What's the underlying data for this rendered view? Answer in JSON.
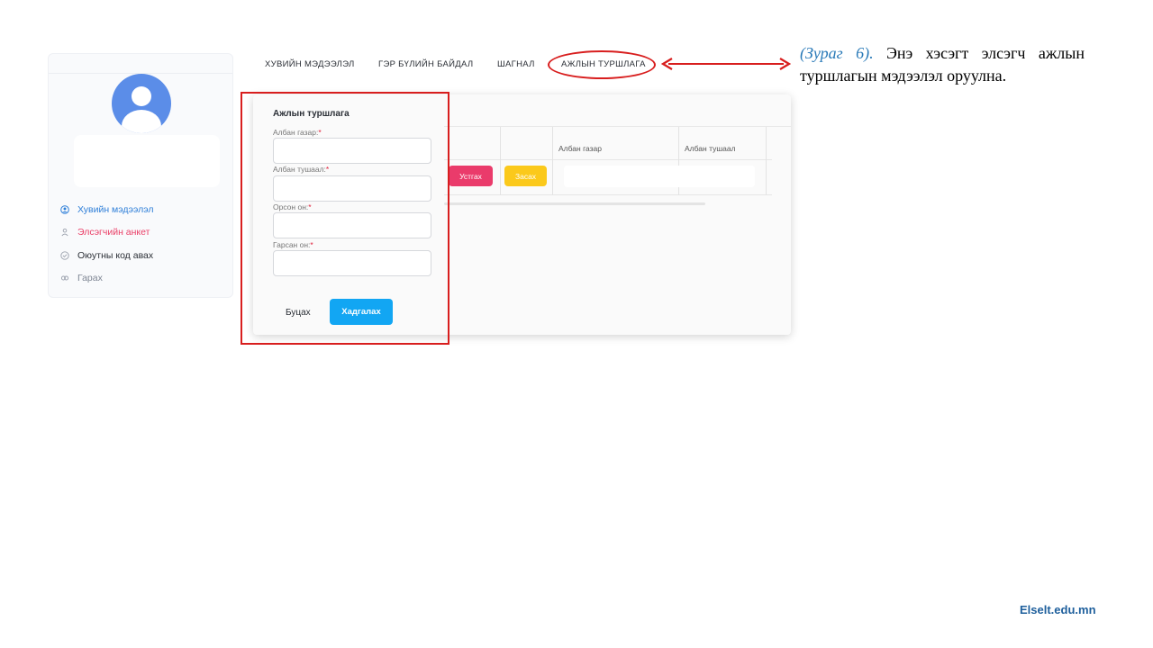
{
  "sidebar": {
    "items": [
      {
        "label": "Хувийн мэдээлэл",
        "icon": "user-circle-icon"
      },
      {
        "label": "Элсэгчийн анкет",
        "icon": "user-icon"
      },
      {
        "label": "Оюутны код авах",
        "icon": "check-circle-icon"
      },
      {
        "label": "Гарах",
        "icon": "logout-icon"
      }
    ]
  },
  "tabs": [
    {
      "label": "ХУВИЙН МЭДЭЭЛЭЛ"
    },
    {
      "label": "ГЭР БҮЛИЙН БАЙДАЛ"
    },
    {
      "label": "ШАГНАЛ"
    },
    {
      "label": "АЖЛЫН ТУРШЛАГА"
    }
  ],
  "annotation": {
    "ref": "(Зураг 6).",
    "text": " Энэ хэсэгт элсэгч ажлын туршлагын  мэдээлэл оруулна."
  },
  "form": {
    "title": "Ажлын туршлага",
    "fields": [
      {
        "label": "Албан газар:",
        "required": "*"
      },
      {
        "label": "Албан тушаал:",
        "required": "*"
      },
      {
        "label": "Орсон он:",
        "required": "*"
      },
      {
        "label": "Гарсан он:",
        "required": "*"
      }
    ],
    "back_label": "Буцах",
    "save_label": "Хадгалах"
  },
  "table": {
    "columns": [
      "Албан газар",
      "Албан тушаал"
    ],
    "delete_label": "Устгах",
    "edit_label": "Засах"
  },
  "footer": {
    "brand": "Elselt.edu.mn"
  },
  "colors": {
    "highlight": "#d81e1e",
    "primary": "#12a6f3",
    "delete": "#ea3b6b",
    "edit": "#fbc91b",
    "avatar": "#5b8de8"
  }
}
